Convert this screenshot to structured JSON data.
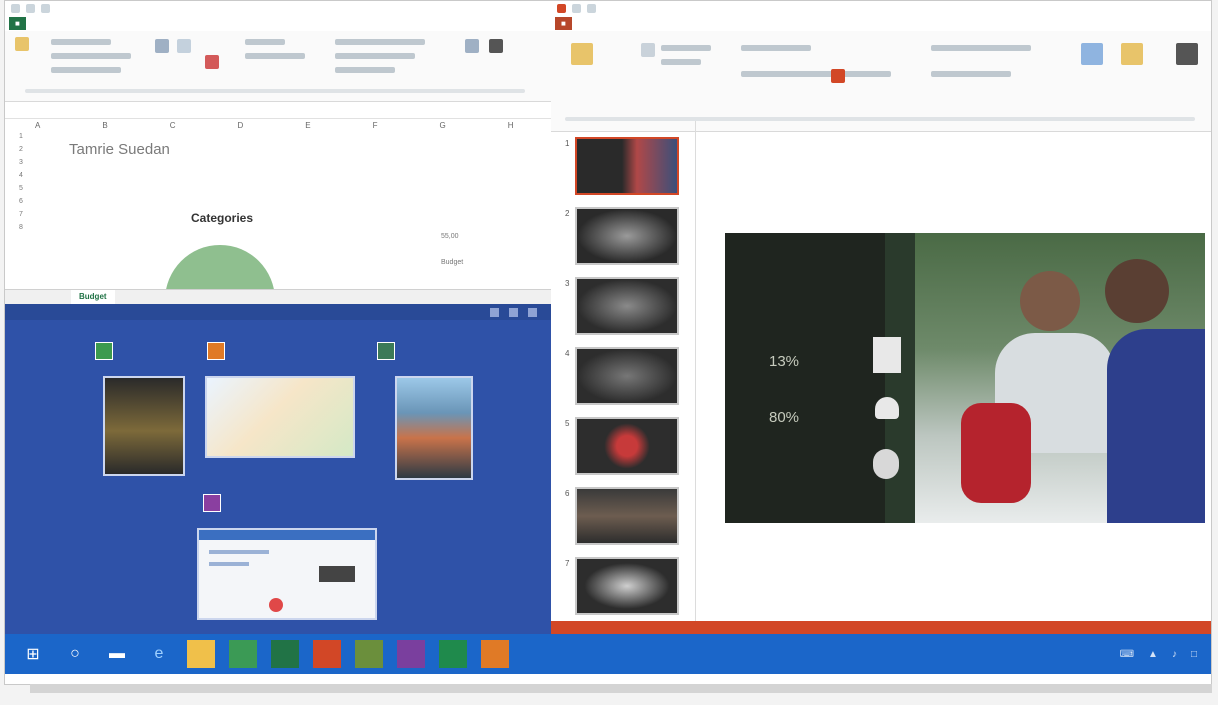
{
  "excel": {
    "sheet_title": "Tamrie Suedan",
    "chart_title": "Categories",
    "chart_labels": [
      "55,00",
      "Budget"
    ],
    "active_sheet": "Budget",
    "column_headers": [
      "A",
      "B",
      "C",
      "D",
      "E",
      "F",
      "G",
      "H"
    ],
    "row_numbers": [
      "1",
      "2",
      "3",
      "4",
      "5",
      "6",
      "7",
      "8"
    ]
  },
  "powerpoint": {
    "slide_numbers": [
      "1",
      "2",
      "3",
      "4",
      "5",
      "6",
      "7"
    ],
    "stats": [
      {
        "value": "13%"
      },
      {
        "value": "80%"
      }
    ]
  },
  "colors": {
    "excel_green": "#217346",
    "powerpoint_red": "#d24726",
    "taskbar_blue": "#1b66c9",
    "start_blue": "#2f52a8"
  },
  "taskbar": {
    "icons": [
      "windows-logo-icon",
      "search-icon",
      "task-view-icon",
      "internet-explorer-icon",
      "file-explorer-icon",
      "store-icon",
      "excel-icon",
      "powerpoint-icon",
      "photos-icon",
      "onenote-icon",
      "excel-icon-2",
      "powerpoint-icon-2"
    ]
  }
}
